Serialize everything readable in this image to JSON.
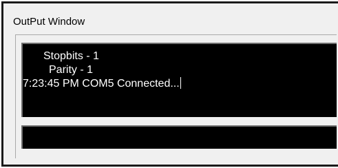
{
  "window": {
    "title": "OutPut Window"
  },
  "output": {
    "lines": [
      "Stopbits - 1",
      "Parity - 1",
      "7:23:45 PM COM5 Connected..."
    ]
  },
  "input": {
    "value": ""
  },
  "colors": {
    "background": "#f0f0f0",
    "console_background": "#000000",
    "console_text": "#ffffff"
  }
}
